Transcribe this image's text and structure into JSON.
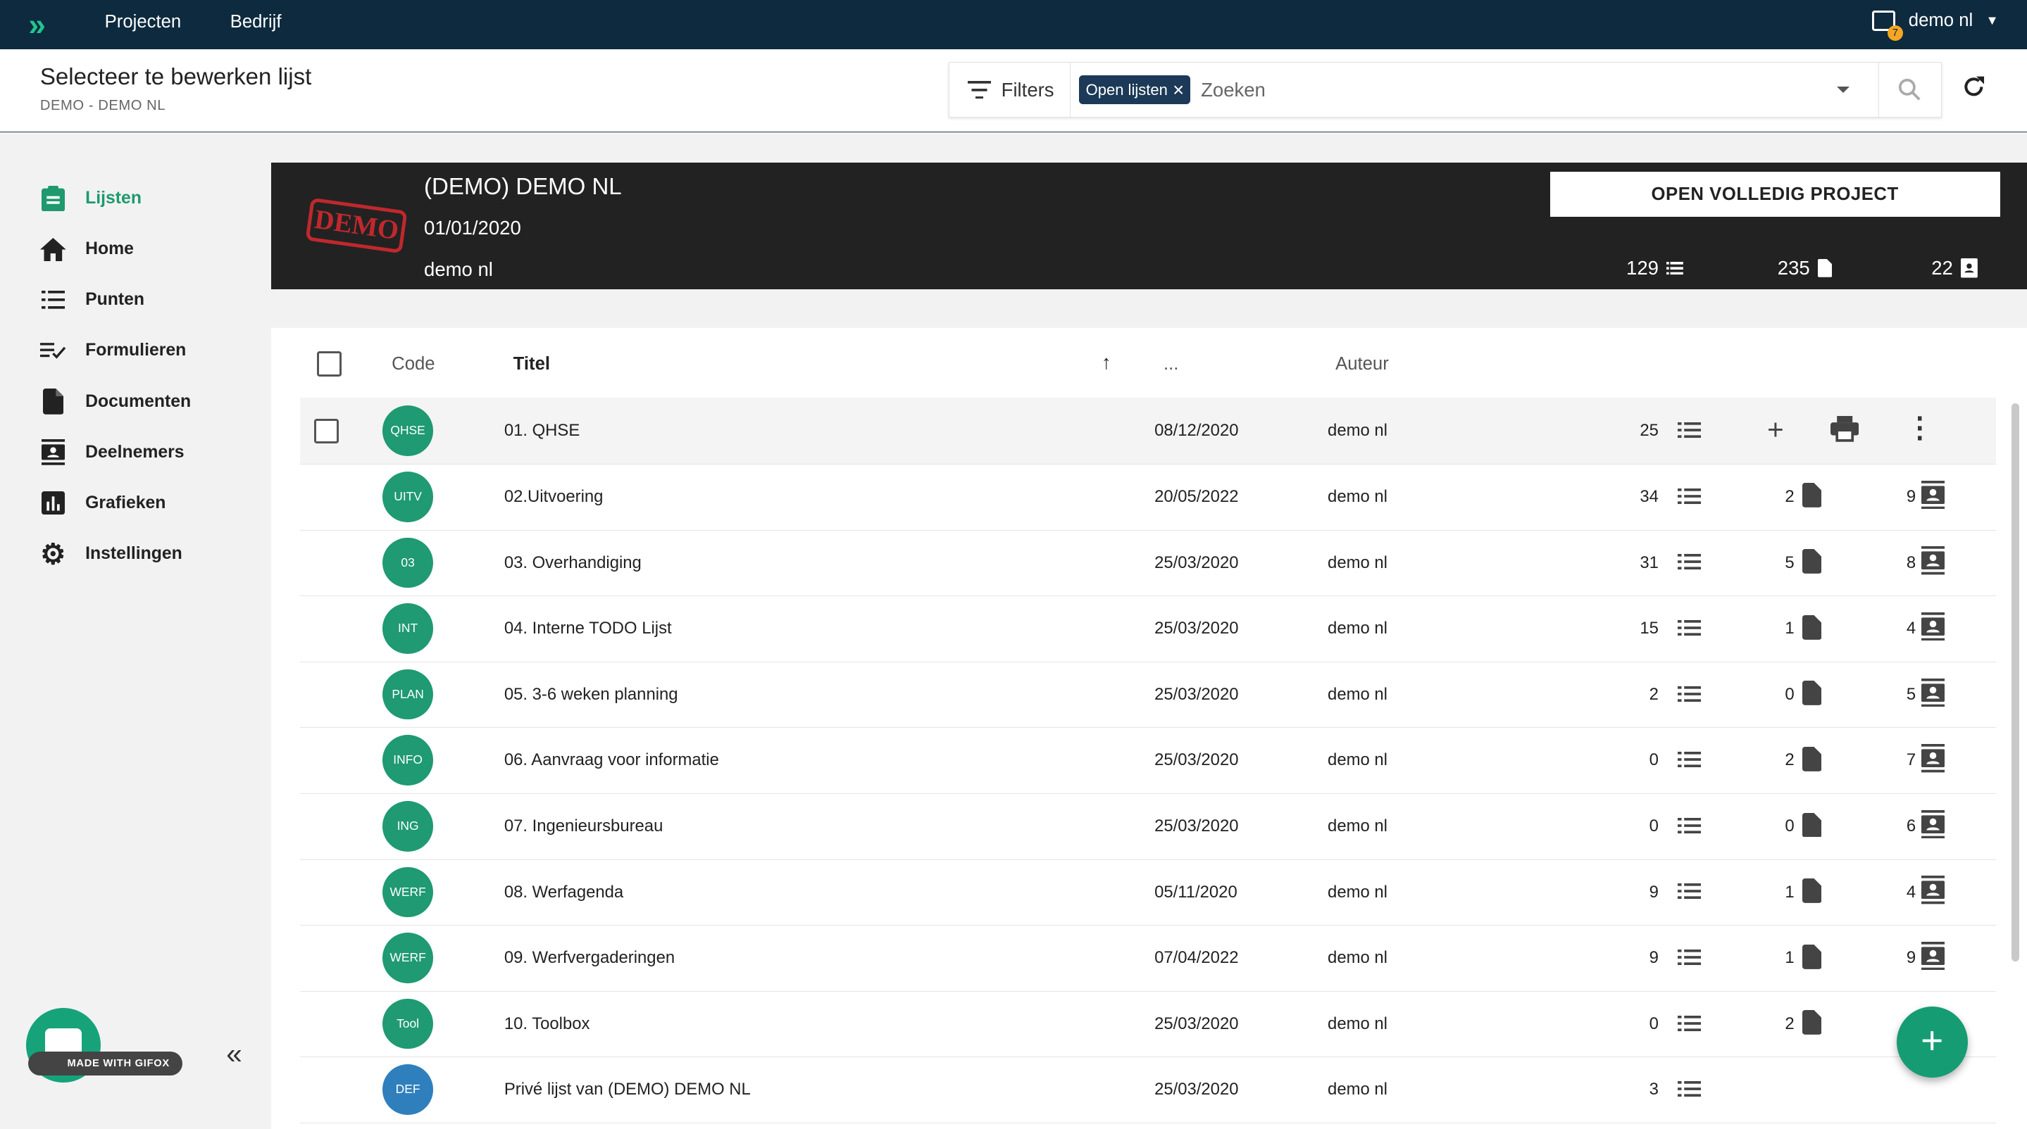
{
  "topbar": {
    "logo": "»",
    "nav": [
      "Projecten",
      "Bedrijf"
    ],
    "notification_count": "7",
    "user": "demo nl"
  },
  "header": {
    "title": "Selecteer te bewerken lijst",
    "breadcrumb": "DEMO - DEMO NL",
    "filters_label": "Filters",
    "chip_label": "Open lijsten",
    "search_placeholder": "Zoeken"
  },
  "sidebar": {
    "items": [
      {
        "label": "Lijsten",
        "icon": "clipboard-list-icon"
      },
      {
        "label": "Home",
        "icon": "home-icon"
      },
      {
        "label": "Punten",
        "icon": "list-icon"
      },
      {
        "label": "Formulieren",
        "icon": "checklist-icon"
      },
      {
        "label": "Documenten",
        "icon": "document-icon"
      },
      {
        "label": "Deelnemers",
        "icon": "contacts-icon"
      },
      {
        "label": "Grafieken",
        "icon": "bar-chart-icon"
      },
      {
        "label": "Instellingen",
        "icon": "gear-icon"
      }
    ],
    "active": "Lijsten",
    "gifox_label": "MADE WITH GIFOX"
  },
  "project": {
    "stamp": "DEMO",
    "name": "(DEMO) DEMO NL",
    "date": "01/01/2020",
    "user": "demo nl",
    "open_button": "OPEN VOLLEDIG PROJECT",
    "stats": {
      "points": "129",
      "documents": "235",
      "participants": "22"
    }
  },
  "table": {
    "headers": {
      "code": "Code",
      "title": "Titel",
      "more": "...",
      "author": "Auteur"
    },
    "rows": [
      {
        "code": "QHSE",
        "title": "01. QHSE",
        "date": "08/12/2020",
        "author": "demo nl",
        "points": "25",
        "docs": "",
        "participants": "",
        "hover": true
      },
      {
        "code": "UITV",
        "title": "02.Uitvoering",
        "date": "20/05/2022",
        "author": "demo nl",
        "points": "34",
        "docs": "2",
        "participants": "9"
      },
      {
        "code": "03",
        "title": "03. Overhandiging",
        "date": "25/03/2020",
        "author": "demo nl",
        "points": "31",
        "docs": "5",
        "participants": "8"
      },
      {
        "code": "INT",
        "title": "04. Interne TODO Lijst",
        "date": "25/03/2020",
        "author": "demo nl",
        "points": "15",
        "docs": "1",
        "participants": "4"
      },
      {
        "code": "PLAN",
        "title": "05. 3-6 weken planning",
        "date": "25/03/2020",
        "author": "demo nl",
        "points": "2",
        "docs": "0",
        "participants": "5"
      },
      {
        "code": "INFO",
        "title": "06. Aanvraag voor informatie",
        "date": "25/03/2020",
        "author": "demo nl",
        "points": "0",
        "docs": "2",
        "participants": "7"
      },
      {
        "code": "ING",
        "title": "07. Ingenieursbureau",
        "date": "25/03/2020",
        "author": "demo nl",
        "points": "0",
        "docs": "0",
        "participants": "6"
      },
      {
        "code": "WERF",
        "title": "08. Werfagenda",
        "date": "05/11/2020",
        "author": "demo nl",
        "points": "9",
        "docs": "1",
        "participants": "4"
      },
      {
        "code": "WERF",
        "title": "09. Werfvergaderingen",
        "date": "07/04/2022",
        "author": "demo nl",
        "points": "9",
        "docs": "1",
        "participants": "9"
      },
      {
        "code": "Tool",
        "title": "10. Toolbox",
        "date": "25/03/2020",
        "author": "demo nl",
        "points": "0",
        "docs": "2",
        "participants": ""
      },
      {
        "code": "DEF",
        "title": "Privé lijst van (DEMO) DEMO NL",
        "date": "25/03/2020",
        "author": "demo nl",
        "points": "3",
        "docs": "",
        "participants": "",
        "avatar_color": "#2f7fbd"
      }
    ]
  },
  "colors": {
    "topbar": "#0e2a3f",
    "accent": "#1f9a72",
    "banner": "#222222",
    "chip": "#1c3a57"
  }
}
